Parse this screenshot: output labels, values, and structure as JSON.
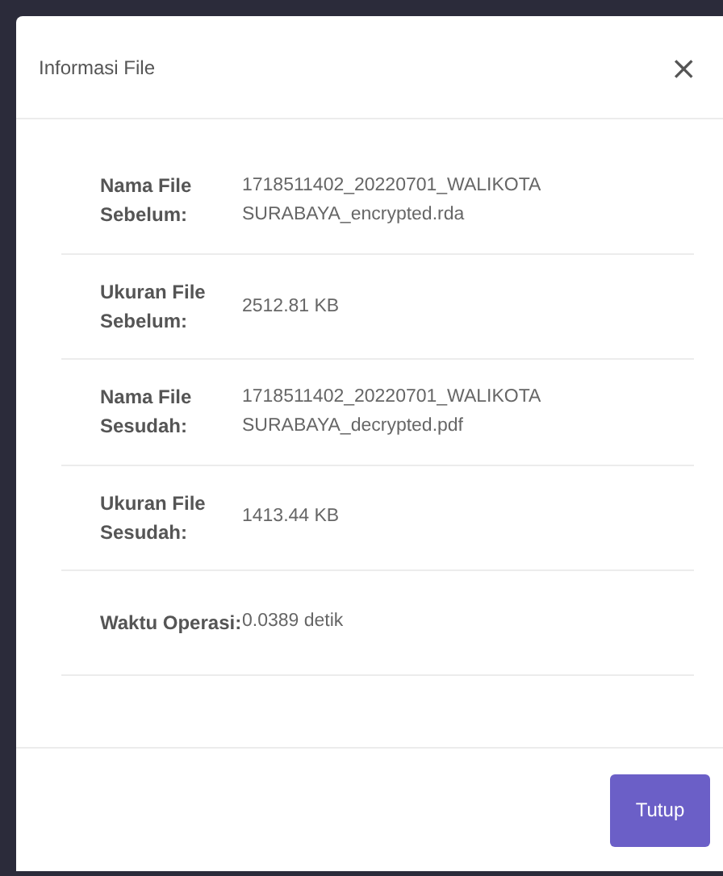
{
  "dialog": {
    "title": "Informasi File",
    "close": "×"
  },
  "rows": [
    {
      "label": "Nama File Sebelum:",
      "value": "1718511402_20220701_WALIKOTA SURABAYA_encrypted.rda"
    },
    {
      "label": "Ukuran File Sebelum:",
      "value": "2512.81 KB"
    },
    {
      "label": "Nama File Sesudah:",
      "value": "1718511402_20220701_WALIKOTA SURABAYA_decrypted.pdf"
    },
    {
      "label": "Ukuran File Sesudah:",
      "value": "1413.44 KB"
    },
    {
      "label": "Waktu Operasi:",
      "value": "0.0389 detik"
    }
  ],
  "buttons": [
    "Tutup"
  ]
}
